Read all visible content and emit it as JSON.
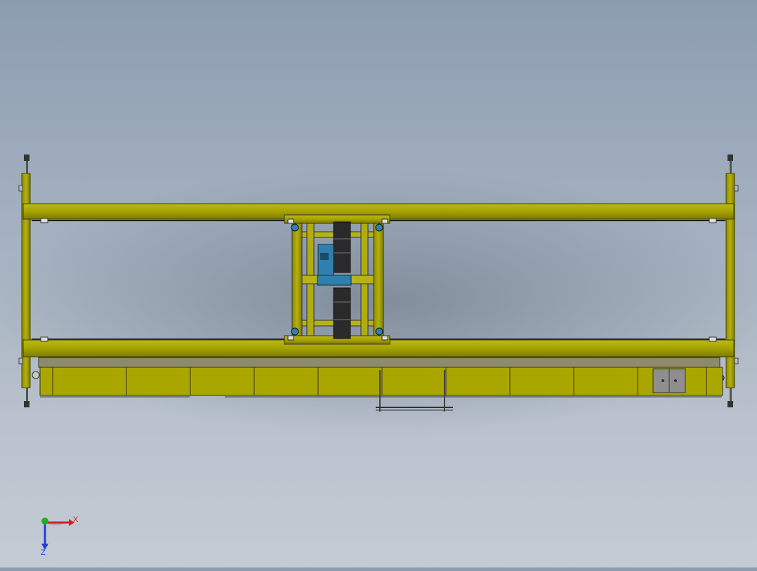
{
  "viewport": {
    "background_top": "#8c9db0",
    "background_bottom": "#c4cbd4"
  },
  "model": {
    "structure_color": "#a6a300",
    "structure_dark": "#6f6d00",
    "motor_color": "#2f7fb0",
    "drum_color": "#2a2a2a",
    "panel_color": "#8e8e8e"
  },
  "triad": {
    "x_label": "X",
    "z_label": "Z",
    "x_color": "#d42020",
    "y_color": "#20b020",
    "z_color": "#2040d0"
  }
}
